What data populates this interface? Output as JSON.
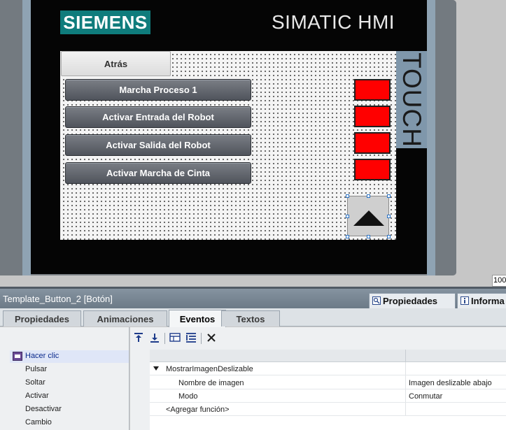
{
  "hmi": {
    "logo": "SIEMENS",
    "brand": "SIMATIC HMI",
    "touch_label": "TOUCH",
    "back_button": "Atrás",
    "buttons": [
      "Marcha Proceso 1",
      "Activar Entrada del Robot",
      "Activar Salida del Robot",
      "Activar Marcha de Cinta"
    ],
    "indicator_color": "#ff0000",
    "zoom_value": "100"
  },
  "panel": {
    "title": "Template_Button_2 [Botón]",
    "top_tabs": [
      "Propiedades",
      "Informa"
    ],
    "tabs": [
      "Propiedades",
      "Animaciones",
      "Eventos",
      "Textos"
    ],
    "active_tab": "Eventos",
    "events": [
      "Hacer clic",
      "Pulsar",
      "Soltar",
      "Activar",
      "Desactivar",
      "Cambio"
    ],
    "selected_event": "Hacer clic",
    "function": {
      "name": "MostrarImagenDeslizable",
      "params": [
        {
          "name": "Nombre de imagen",
          "value": "Imagen deslizable abajo"
        },
        {
          "name": "Modo",
          "value": "Conmutar"
        }
      ],
      "add_label": "<Agregar función>"
    }
  }
}
